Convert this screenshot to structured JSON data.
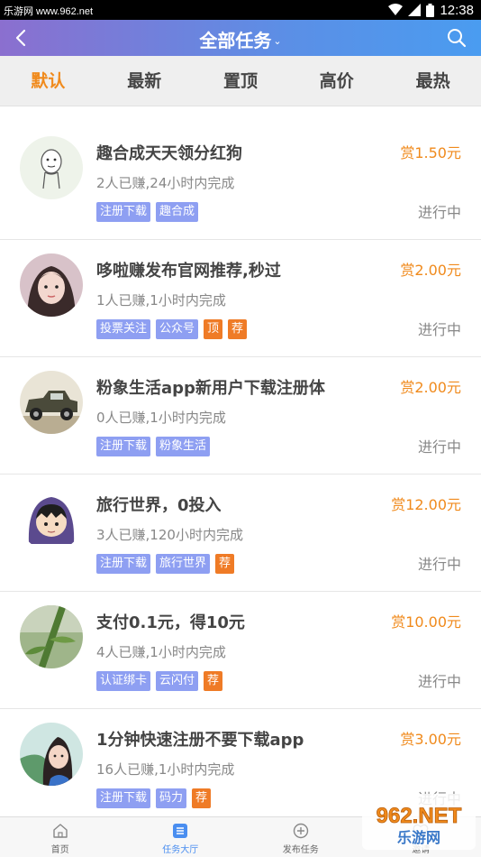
{
  "status_bar": {
    "left_text": "乐游网 www.962.net",
    "time": "12:38"
  },
  "header": {
    "title": "全部任务",
    "caret": "⌄"
  },
  "tabs": [
    {
      "label": "默认",
      "active": true
    },
    {
      "label": "最新",
      "active": false
    },
    {
      "label": "置顶",
      "active": false
    },
    {
      "label": "高价",
      "active": false
    },
    {
      "label": "最热",
      "active": false
    }
  ],
  "tasks": [
    {
      "name": "趣合成天天领分红狗",
      "meta": "2人已赚,24小时内完成",
      "reward": "赏1.50元",
      "status": "进行中",
      "tags": [
        {
          "text": "注册下载",
          "color": "blue"
        },
        {
          "text": "趣合成",
          "color": "blue"
        }
      ]
    },
    {
      "name": "哆啦赚发布官网推荐,秒过",
      "meta": "1人已赚,1小时内完成",
      "reward": "赏2.00元",
      "status": "进行中",
      "tags": [
        {
          "text": "投票关注",
          "color": "blue"
        },
        {
          "text": "公众号",
          "color": "blue"
        },
        {
          "text": "顶",
          "color": "orange"
        },
        {
          "text": "荐",
          "color": "orange"
        }
      ]
    },
    {
      "name": "粉象生活app新用户下载注册体",
      "meta": "0人已赚,1小时内完成",
      "reward": "赏2.00元",
      "status": "进行中",
      "tags": [
        {
          "text": "注册下载",
          "color": "blue"
        },
        {
          "text": "粉象生活",
          "color": "blue"
        }
      ]
    },
    {
      "name": "旅行世界，0投入",
      "meta": "3人已赚,120小时内完成",
      "reward": "赏12.00元",
      "status": "进行中",
      "tags": [
        {
          "text": "注册下载",
          "color": "blue"
        },
        {
          "text": "旅行世界",
          "color": "blue"
        },
        {
          "text": "荐",
          "color": "orange"
        }
      ]
    },
    {
      "name": "支付0.1元，得10元",
      "meta": "4人已赚,1小时内完成",
      "reward": "赏10.00元",
      "status": "进行中",
      "tags": [
        {
          "text": "认证绑卡",
          "color": "blue"
        },
        {
          "text": "云闪付",
          "color": "blue"
        },
        {
          "text": "荐",
          "color": "orange"
        }
      ]
    },
    {
      "name": "1分钟快速注册不要下载app",
      "meta": "16人已赚,1小时内完成",
      "reward": "赏3.00元",
      "status": "进行中",
      "tags": [
        {
          "text": "注册下载",
          "color": "blue"
        },
        {
          "text": "码力",
          "color": "blue"
        },
        {
          "text": "荐",
          "color": "orange"
        }
      ]
    }
  ],
  "bottom_nav": [
    {
      "label": "首页",
      "icon": "home-icon",
      "active": false
    },
    {
      "label": "任务大厅",
      "icon": "task-list-icon",
      "active": true
    },
    {
      "label": "发布任务",
      "icon": "plus-circle-icon",
      "active": false
    },
    {
      "label": "邀请",
      "icon": "heart-icon",
      "active": false
    }
  ],
  "watermark": {
    "text": "962.NET",
    "subtext": "乐游网"
  },
  "colors": {
    "accent": "#f08a1c",
    "tag_blue": "#8e9ff2",
    "tag_orange": "#ef7b26",
    "nav_active": "#4a8ef0"
  }
}
